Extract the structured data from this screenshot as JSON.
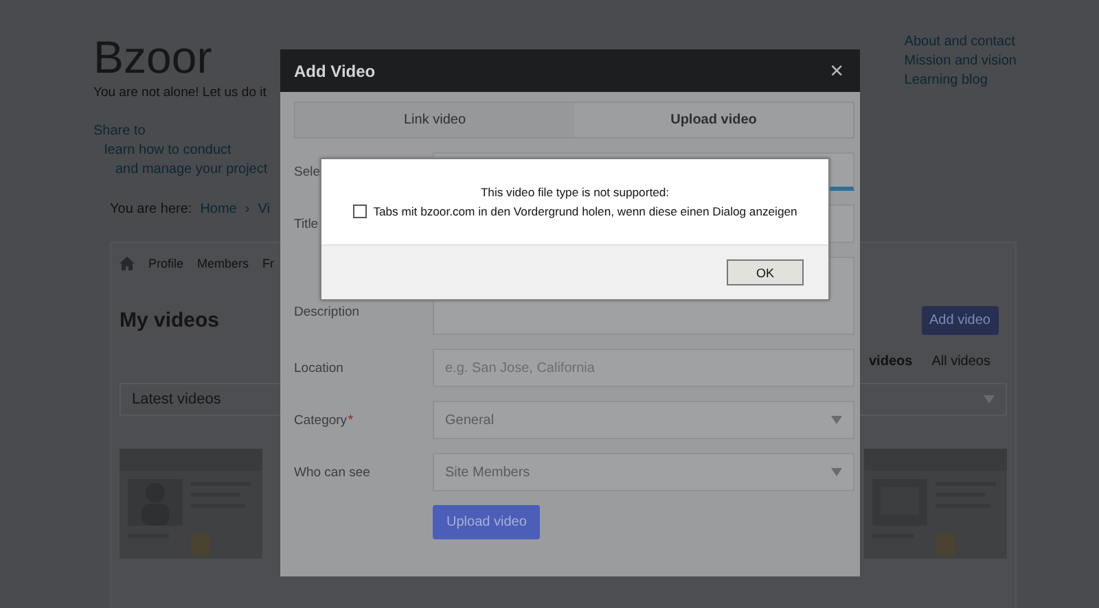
{
  "page": {
    "logo": "Bzoor",
    "tagline": "You are not alone! Let us do it",
    "share": [
      "Share to",
      "learn how to conduct",
      "and manage your project"
    ],
    "breadcrumb": {
      "label": "You are here:",
      "items": [
        "Home",
        "›",
        "Vi"
      ]
    },
    "sidebar_links": [
      "About and contact",
      "Mission and vision",
      "Learning blog"
    ],
    "nav": [
      "Profile",
      "Members",
      "Fr"
    ],
    "heading": "My videos",
    "add_button": "Add video",
    "video_tabs": [
      {
        "label": "videos",
        "selected": true
      },
      {
        "label": "All videos",
        "selected": false
      }
    ],
    "sort": {
      "value": "Latest videos"
    }
  },
  "modal": {
    "title": "Add Video",
    "close": "×",
    "tabs": [
      {
        "label": "Link video",
        "selected": false
      },
      {
        "label": "Upload video",
        "selected": true
      }
    ],
    "fields": [
      {
        "kind": "upload",
        "label": "Sele"
      },
      {
        "kind": "text",
        "label": "Title"
      },
      {
        "kind": "textarea",
        "label": "Description"
      },
      {
        "kind": "text",
        "label": "Location",
        "placeholder": "e.g. San Jose, California"
      },
      {
        "kind": "select",
        "label": "Category",
        "required_mark": "*",
        "value": "General"
      },
      {
        "kind": "select",
        "label": "Who can see",
        "value": "Site Members"
      }
    ],
    "submit": "Upload video"
  },
  "alert": {
    "message": "This video file type is not supported:",
    "checkbox": {
      "label": "Tabs mit bzoor.com in den Vordergrund holen, wenn diese einen Dialog anzeigen",
      "checked": false
    },
    "button": "OK"
  }
}
